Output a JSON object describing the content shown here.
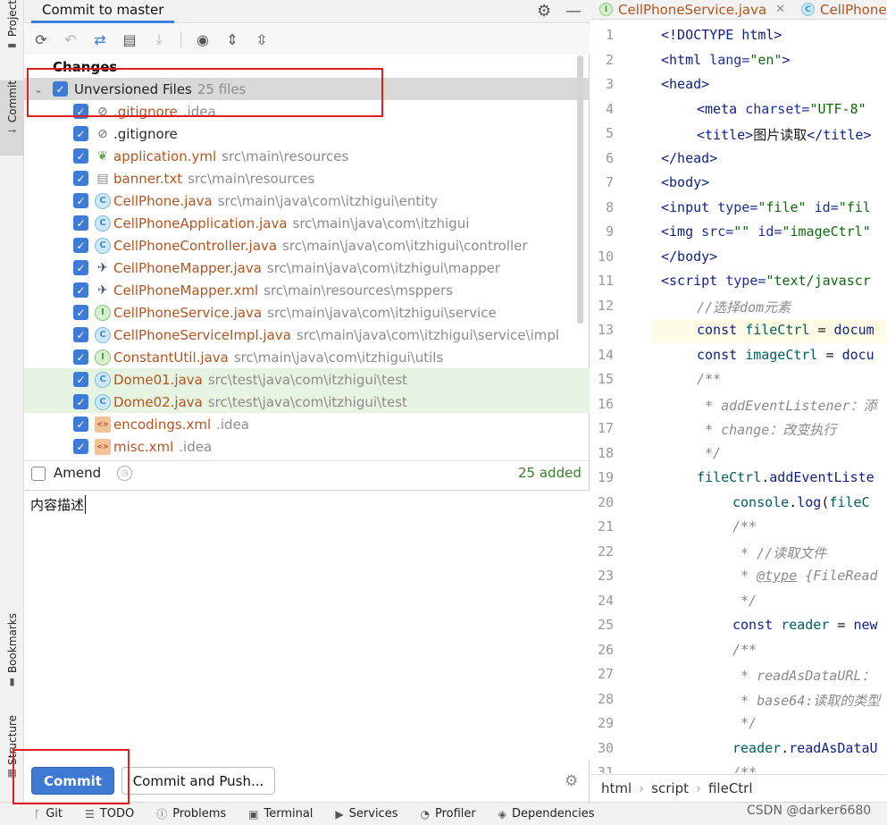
{
  "left_strip": {
    "project": "Project",
    "commit": "Commit",
    "bookmarks": "Bookmarks",
    "structure": "Structure"
  },
  "panel": {
    "tab_title": "Commit to master"
  },
  "changes_label": "Changes",
  "group": {
    "name": "Unversioned Files",
    "count": "25 files"
  },
  "files": [
    {
      "name": ".gitignore",
      "path": ".idea",
      "icon": "ignore-icon",
      "highlight": false
    },
    {
      "name": ".gitignore",
      "path": "",
      "icon": "ignore-icon",
      "highlight": false
    },
    {
      "name": "application.yml",
      "path": "src\\main\\resources",
      "icon": "spring-config-icon",
      "highlight": false
    },
    {
      "name": "banner.txt",
      "path": "src\\main\\resources",
      "icon": "text-file-icon",
      "highlight": false
    },
    {
      "name": "CellPhone.java",
      "path": "src\\main\\java\\com\\itzhigui\\entity",
      "icon": "java-class-icon",
      "highlight": false
    },
    {
      "name": "CellPhoneApplication.java",
      "path": "src\\main\\java\\com\\itzhigui",
      "icon": "java-class-icon",
      "highlight": false
    },
    {
      "name": "CellPhoneController.java",
      "path": "src\\main\\java\\com\\itzhigui\\controller",
      "icon": "java-class-icon",
      "highlight": false
    },
    {
      "name": "CellPhoneMapper.java",
      "path": "src\\main\\java\\com\\itzhigui\\mapper",
      "icon": "mybatis-icon",
      "highlight": false
    },
    {
      "name": "CellPhoneMapper.xml",
      "path": "src\\main\\resources\\msppers",
      "icon": "mybatis-xml-icon",
      "highlight": false
    },
    {
      "name": "CellPhoneService.java",
      "path": "src\\main\\java\\com\\itzhigui\\service",
      "icon": "java-interface-icon",
      "highlight": false
    },
    {
      "name": "CellPhoneServiceImpl.java",
      "path": "src\\main\\java\\com\\itzhigui\\service\\impl",
      "icon": "java-class-icon",
      "highlight": false
    },
    {
      "name": "ConstantUtil.java",
      "path": "src\\main\\java\\com\\itzhigui\\utils",
      "icon": "java-interface-icon",
      "highlight": false
    },
    {
      "name": "Dome01.java",
      "path": "src\\test\\java\\com\\itzhigui\\test",
      "icon": "java-class-icon",
      "highlight": true
    },
    {
      "name": "Dome02.java",
      "path": "src\\test\\java\\com\\itzhigui\\test",
      "icon": "java-class-icon",
      "highlight": true
    },
    {
      "name": "encodings.xml",
      "path": ".idea",
      "icon": "xml-icon",
      "highlight": false
    },
    {
      "name": "misc.xml",
      "path": ".idea",
      "icon": "xml-icon",
      "highlight": false
    }
  ],
  "amend": {
    "label": "Amend",
    "added": "25 added"
  },
  "message": "内容描述",
  "buttons": {
    "commit": "Commit",
    "commit_push": "Commit and Push..."
  },
  "editor_tabs": [
    {
      "label": "CellPhoneService.java",
      "icon": "java-interface-icon"
    },
    {
      "label": "CellPhoneS",
      "icon": "java-class-icon"
    }
  ],
  "breadcrumb": [
    "html",
    "script",
    "fileCtrl"
  ],
  "status_bar": [
    {
      "label": "Git",
      "icon": "git-icon"
    },
    {
      "label": "TODO",
      "icon": "todo-icon"
    },
    {
      "label": "Problems",
      "icon": "problems-icon"
    },
    {
      "label": "Terminal",
      "icon": "terminal-icon"
    },
    {
      "label": "Services",
      "icon": "services-icon"
    },
    {
      "label": "Profiler",
      "icon": "profiler-icon"
    },
    {
      "label": "Dependencies",
      "icon": "dependencies-icon"
    }
  ],
  "watermark": "CSDN @darker6680",
  "code_lines": [
    "1",
    "2",
    "3",
    "4",
    "5",
    "6",
    "7",
    "8",
    "9",
    "10",
    "11",
    "12",
    "13",
    "14",
    "15",
    "16",
    "17",
    "18",
    "19",
    "20",
    "21",
    "22",
    "23",
    "24",
    "25",
    "26",
    "27",
    "28",
    "29",
    "30",
    "31"
  ]
}
